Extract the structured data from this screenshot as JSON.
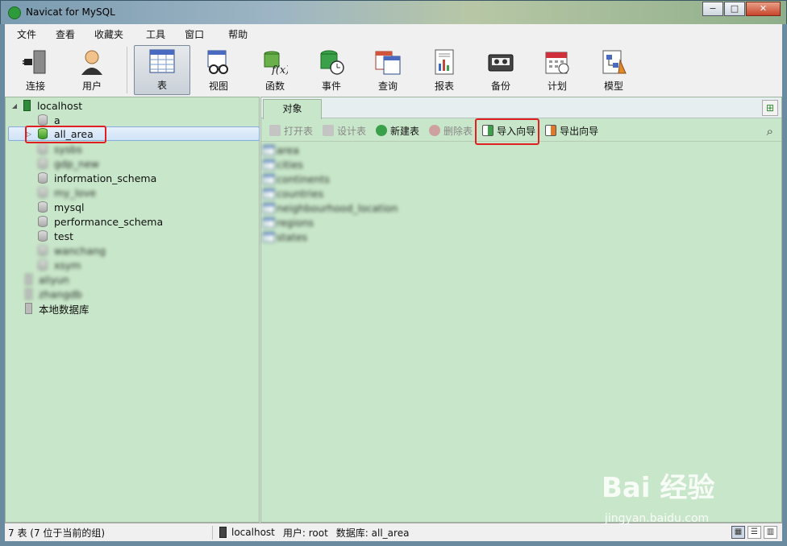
{
  "window": {
    "title": "Navicat for MySQL",
    "buttons": {
      "min": "−",
      "max": "□",
      "close": "✕"
    }
  },
  "menu": [
    "文件",
    "查看",
    "收藏夹",
    "工具",
    "窗口",
    "帮助"
  ],
  "toolbar": [
    {
      "label": "连接",
      "icon": "plug-icon"
    },
    {
      "label": "用户",
      "icon": "user-icon"
    },
    {
      "label": "表",
      "icon": "table-icon",
      "active": true
    },
    {
      "label": "视图",
      "icon": "view-icon"
    },
    {
      "label": "函数",
      "icon": "function-icon",
      "glyph": "f(x)"
    },
    {
      "label": "事件",
      "icon": "event-icon"
    },
    {
      "label": "查询",
      "icon": "query-icon"
    },
    {
      "label": "报表",
      "icon": "report-icon"
    },
    {
      "label": "备份",
      "icon": "backup-icon"
    },
    {
      "label": "计划",
      "icon": "schedule-icon"
    },
    {
      "label": "模型",
      "icon": "model-icon"
    }
  ],
  "tree": {
    "connection": "localhost",
    "databases": [
      "a",
      "all_area",
      "sysbs",
      "gdp_new",
      "information_schema",
      "my_love",
      "mysql",
      "performance_schema",
      "test",
      "wanchang",
      "xsym"
    ],
    "other_connections": [
      "aliyun",
      "zhangdb",
      "本地数据库"
    ]
  },
  "tabs": {
    "objects": "对象"
  },
  "objbar": {
    "open": "打开表",
    "design": "设计表",
    "new": "新建表",
    "delete": "删除表",
    "import": "导入向导",
    "export": "导出向导"
  },
  "tables": [
    "area",
    "cities",
    "continents",
    "countries",
    "neighbourhood_location",
    "regions",
    "states"
  ],
  "status": {
    "count": "7 表 (7 位于当前的组)",
    "conn": "localhost",
    "user": "用户: root",
    "db": "数据库: all_area"
  },
  "watermark": {
    "main": "Bai 经验",
    "sub": "jingyan.baidu.com"
  },
  "colors": {
    "pane_bg": "#c8e6c9",
    "highlight": "#e02020"
  }
}
